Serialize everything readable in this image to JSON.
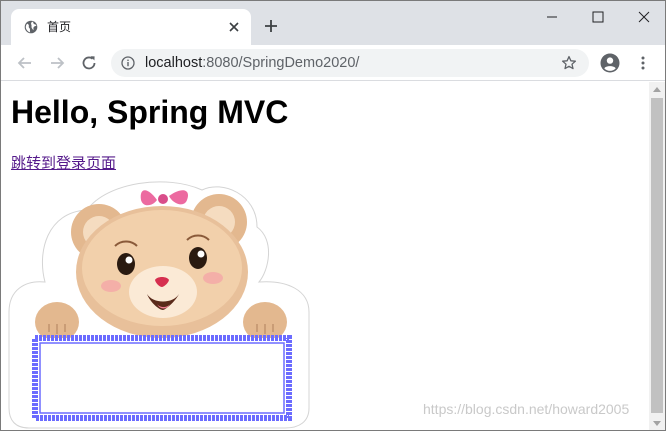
{
  "browser": {
    "tab": {
      "title": "首页",
      "favicon": "globe-icon"
    },
    "address_bar": {
      "host": "localhost",
      "path": ":8080/SpringDemo2020/"
    },
    "icons": {
      "back": "back-arrow-icon",
      "forward": "forward-arrow-icon",
      "reload": "reload-icon",
      "info": "info-icon",
      "bookmark": "star-icon",
      "account": "account-icon",
      "menu": "kebab-menu-icon",
      "minimize": "minimize-icon",
      "maximize": "maximize-icon",
      "close": "close-icon",
      "new_tab": "plus-icon"
    }
  },
  "page": {
    "heading": "Hello, Spring MVC",
    "link_text": "跳转到登录页面",
    "image": "teddy-bear-sign-image",
    "watermark": "https://blog.csdn.net/howard2005"
  },
  "colors": {
    "tabstrip": "#dee1e6",
    "link": "#551a8b",
    "sign_border": "#6b6bff"
  }
}
